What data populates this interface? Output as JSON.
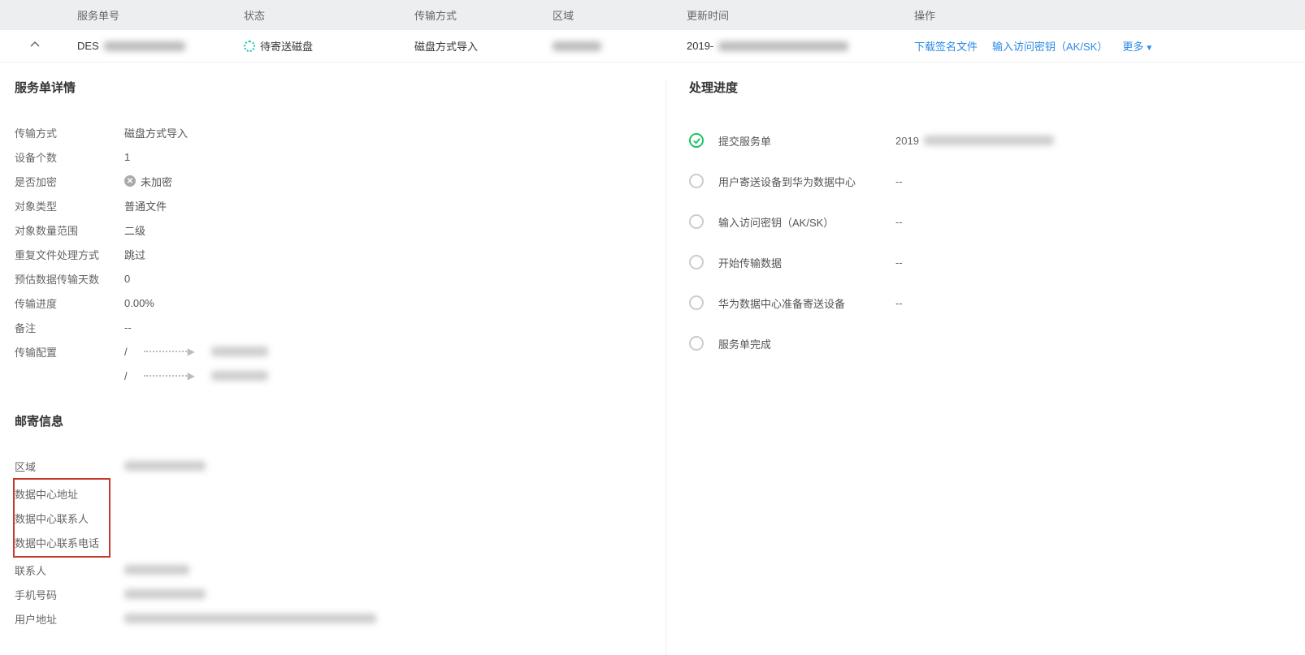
{
  "table": {
    "headers": {
      "id": "服务单号",
      "status": "状态",
      "method": "传输方式",
      "region": "区域",
      "time": "更新时间",
      "ops": "操作"
    },
    "row": {
      "id_prefix": "DES",
      "status_text": "待寄送磁盘",
      "method": "磁盘方式导入",
      "time_prefix": "2019-",
      "op_download": "下载签名文件",
      "op_ak": "输入访问密钥（AK/SK）",
      "op_more": "更多"
    }
  },
  "detail": {
    "title": "服务单详情",
    "rows": {
      "method_label": "传输方式",
      "method_value": "磁盘方式导入",
      "device_count_label": "设备个数",
      "device_count_value": "1",
      "encrypted_label": "是否加密",
      "encrypted_value": "未加密",
      "obj_type_label": "对象类型",
      "obj_type_value": "普通文件",
      "obj_range_label": "对象数量范围",
      "obj_range_value": "二级",
      "dup_label": "重复文件处理方式",
      "dup_value": "跳过",
      "est_days_label": "预估数据传输天数",
      "est_days_value": "0",
      "progress_label": "传输进度",
      "progress_value": "0.00%",
      "remark_label": "备注",
      "remark_value": "--",
      "config_label": "传输配置",
      "config_value1": "/",
      "config_value2": "/"
    }
  },
  "mailing": {
    "title": "邮寄信息",
    "rows": {
      "region_label": "区域",
      "dc_addr_label": "数据中心地址",
      "dc_contact_label": "数据中心联系人",
      "dc_phone_label": "数据中心联系电话",
      "contact_label": "联系人",
      "mobile_label": "手机号码",
      "user_addr_label": "用户地址"
    }
  },
  "progress": {
    "title": "处理进度",
    "steps": [
      {
        "label": "提交服务单",
        "value_prefix": "2019",
        "status": "done"
      },
      {
        "label": "用户寄送设备到华为数据中心",
        "value": "--",
        "status": "pending"
      },
      {
        "label": "输入访问密钥（AK/SK）",
        "value": "--",
        "status": "pending"
      },
      {
        "label": "开始传输数据",
        "value": "--",
        "status": "pending"
      },
      {
        "label": "华为数据中心准备寄送设备",
        "value": "--",
        "status": "pending"
      },
      {
        "label": "服务单完成",
        "value": "",
        "status": "pending"
      }
    ]
  }
}
